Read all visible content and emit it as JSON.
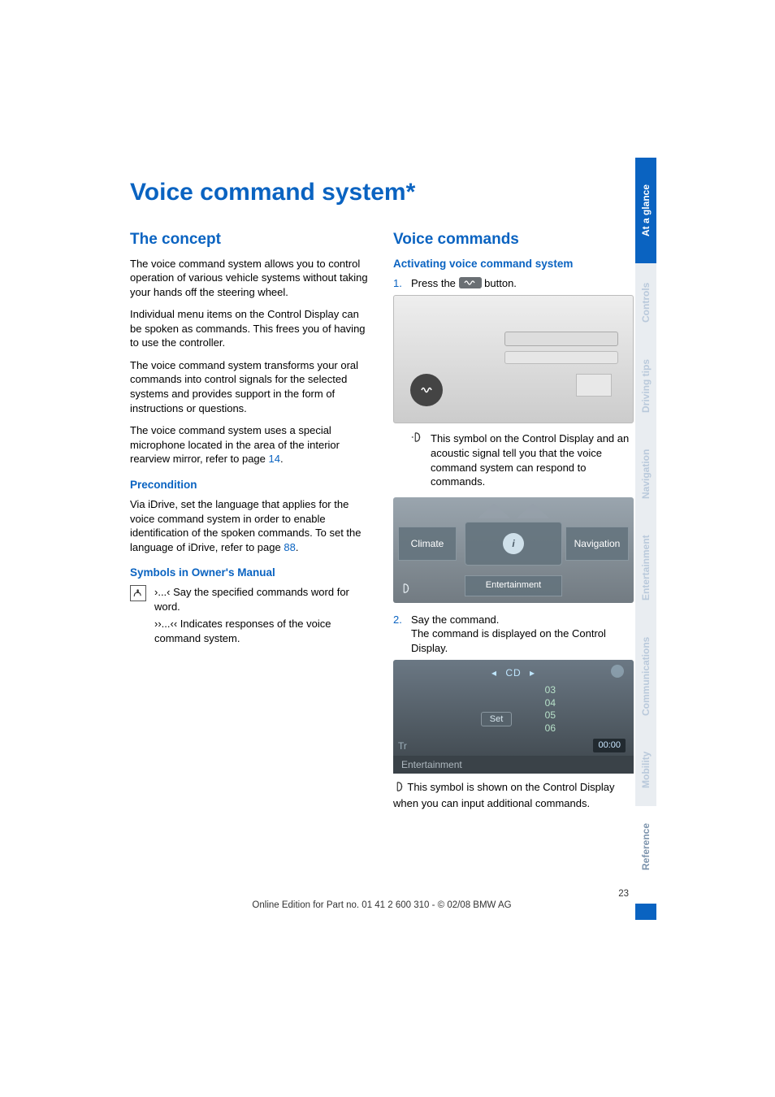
{
  "title": "Voice command system*",
  "left": {
    "h2": "The concept",
    "p1": "The voice command system allows you to control operation of various vehicle systems without taking your hands off the steering wheel.",
    "p2": "Individual menu items on the Control Display can be spoken as commands. This frees you of having to use the controller.",
    "p3": "The voice command system transforms your oral commands into control signals for the selected systems and provides support in the form of instructions or questions.",
    "p4a": "The voice command system uses a special microphone located in the area of the interior rearview mirror, refer to page ",
    "p4_link": "14",
    "p4b": ".",
    "h3a": "Precondition",
    "p5a": "Via iDrive, set the language that applies for the voice command system in order to enable identification of the spoken commands. To set the language of iDrive, refer to page ",
    "p5_link": "88",
    "p5b": ".",
    "h3b": "Symbols in Owner's Manual",
    "sym1": "›...‹ Say the specified commands word for word.",
    "sym2": "››...‹‹ Indicates responses of the voice command system."
  },
  "right": {
    "h2": "Voice commands",
    "h3": "Activating voice command system",
    "step1_num": "1.",
    "step1a": "Press the ",
    "step1b": " button.",
    "note1": "This symbol on the Control Display and an acoustic signal tell you that the voice command system can respond to commands.",
    "menu": {
      "left": "Climate",
      "center_icon": "i",
      "right": "Navigation",
      "bottom": "Entertainment"
    },
    "step2_num": "2.",
    "step2a": "Say the command.",
    "step2b": "The command is displayed on the Control Display.",
    "cd": {
      "label": "CD",
      "nums": [
        "03",
        "04",
        "05",
        "06"
      ],
      "set": "Set",
      "tr": "Tr",
      "time": "00:00",
      "bar": "Entertainment"
    },
    "note2": "This symbol is shown on the Control Display when you can input additional commands."
  },
  "tabs": {
    "at_a_glance": "At a glance",
    "controls": "Controls",
    "driving_tips": "Driving tips",
    "navigation": "Navigation",
    "entertainment": "Entertainment",
    "communications": "Communications",
    "mobility": "Mobility",
    "reference": "Reference"
  },
  "footer": {
    "page": "23",
    "line": "Online Edition for Part no. 01 41 2 600 310 - © 02/08 BMW AG"
  }
}
